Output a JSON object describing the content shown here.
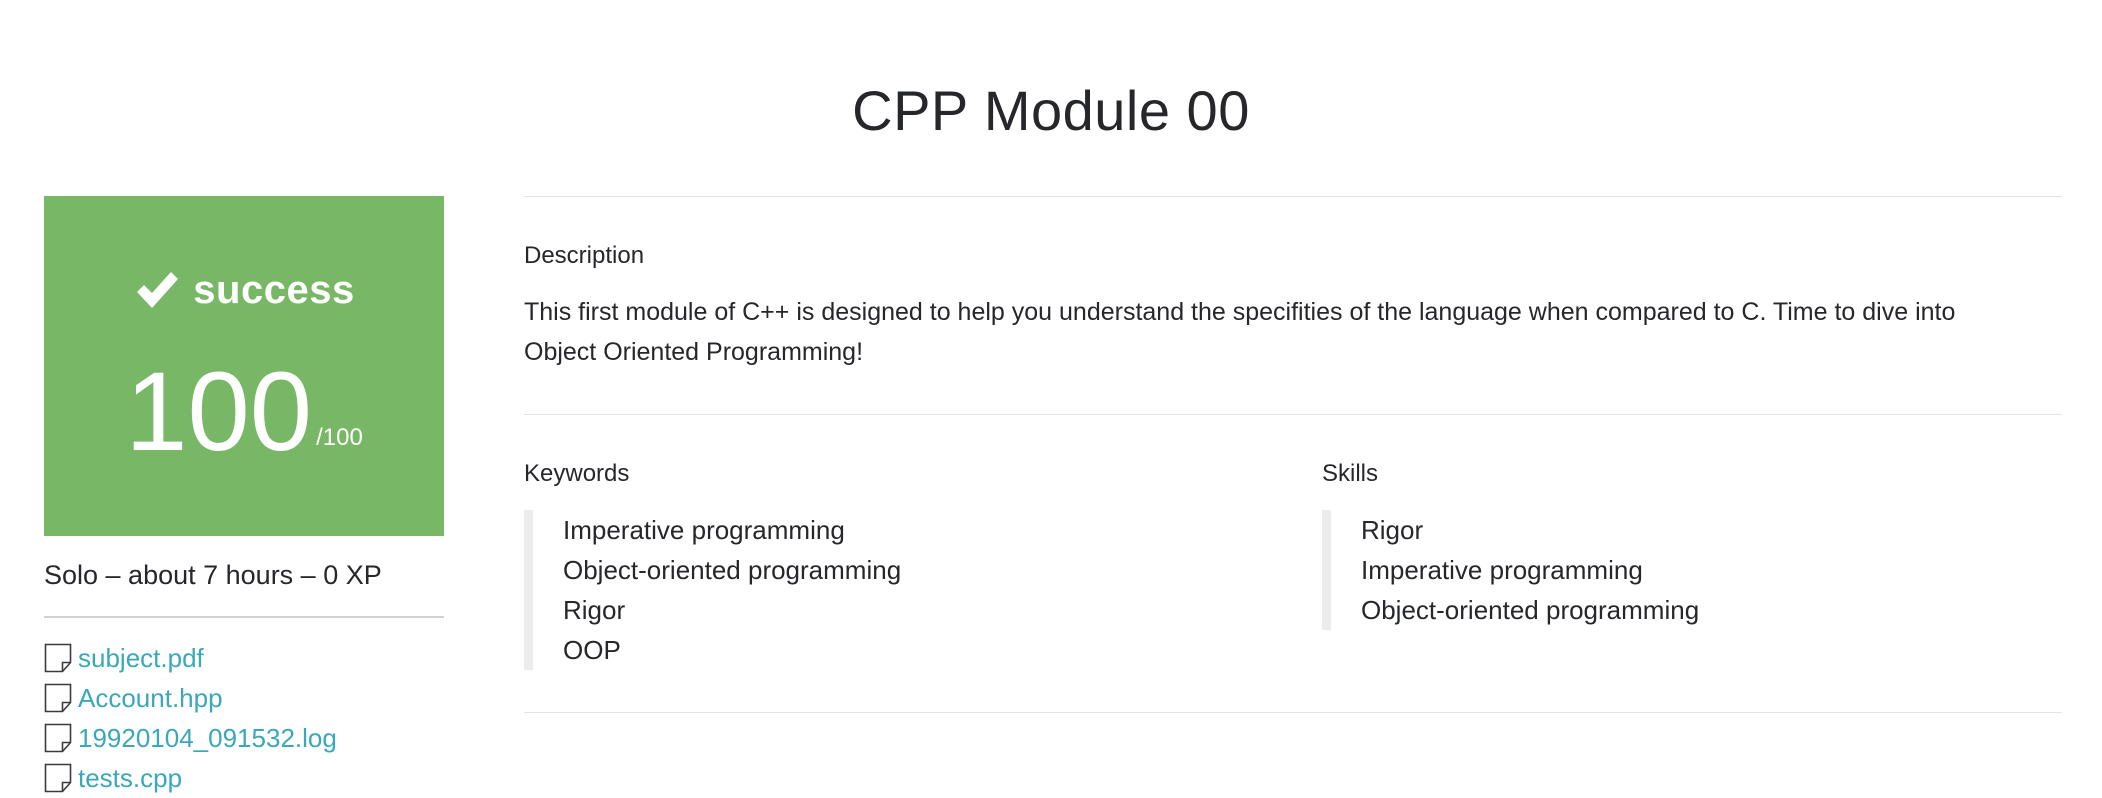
{
  "project": {
    "title": "CPP Module 00"
  },
  "result": {
    "status": "success",
    "score": "100",
    "max_score": "/100",
    "color": "#77b766"
  },
  "meta": {
    "summary": "Solo – about 7 hours – 0 XP"
  },
  "attachments": [
    {
      "name": "subject.pdf",
      "icon": "file-icon"
    },
    {
      "name": "Account.hpp",
      "icon": "file-icon"
    },
    {
      "name": "19920104_091532.log",
      "icon": "file-icon"
    },
    {
      "name": "tests.cpp",
      "icon": "file-icon"
    }
  ],
  "description": {
    "heading": "Description",
    "text": "This first module of C++ is designed to help you understand the specifities of the language when compared to C. Time to dive into Object Oriented Programming!"
  },
  "keywords": {
    "heading": "Keywords",
    "items": [
      "Imperative programming",
      "Object-oriented programming",
      "Rigor",
      "OOP"
    ]
  },
  "skills": {
    "heading": "Skills",
    "items": [
      "Rigor",
      "Imperative programming",
      "Object-oriented programming"
    ]
  },
  "colors": {
    "link": "#3aa8b8",
    "text": "#26272a"
  }
}
